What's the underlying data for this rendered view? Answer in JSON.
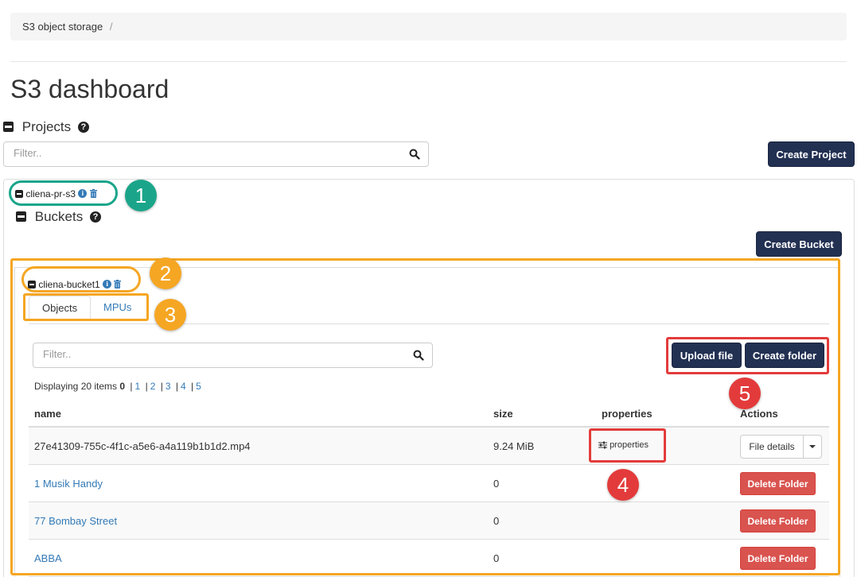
{
  "breadcrumb": {
    "root": "S3 object storage",
    "separator": "/"
  },
  "page_title": "S3 dashboard",
  "projects": {
    "title": "Projects",
    "help_glyph": "?",
    "filter_placeholder": "Filter..",
    "create_button": "Create Project",
    "project_name": "cliena-pr-s3",
    "info_glyph": "i"
  },
  "buckets": {
    "title": "Buckets",
    "help_glyph": "?",
    "create_button": "Create Bucket",
    "bucket_name": "cliena-bucket1",
    "info_glyph": "i"
  },
  "tabs": [
    {
      "label": "Objects",
      "active": true
    },
    {
      "label": "MPUs",
      "active": false
    }
  ],
  "objects": {
    "filter_placeholder": "Filter..",
    "upload_button": "Upload file",
    "create_folder_button": "Create folder",
    "displaying": {
      "prefix": "Displaying 20 items",
      "current": "0",
      "pages": [
        "1",
        "2",
        "3",
        "4",
        "5"
      ]
    },
    "columns": {
      "name": "name",
      "size": "size",
      "properties": "properties",
      "actions": "Actions"
    },
    "rows": [
      {
        "name": "27e41309-755c-4f1c-a5e6-a4a119b1b1d2.mp4",
        "size": "9.24 MiB",
        "properties": "properties",
        "action": "File details"
      },
      {
        "name": "1 Musik Handy",
        "size": "0",
        "action": "Delete Folder"
      },
      {
        "name": "77 Bombay Street",
        "size": "0",
        "action": "Delete Folder"
      },
      {
        "name": "ABBA",
        "size": "0",
        "action": "Delete Folder"
      }
    ]
  },
  "annotations": {
    "labels": [
      "1",
      "2",
      "3",
      "4",
      "5"
    ],
    "colors": {
      "teal": "#1aa58a",
      "orange": "#f5a623",
      "red": "#e33b3b"
    }
  },
  "colors": {
    "primary_dark": "#223052",
    "link": "#337ab7",
    "danger": "#d9534f"
  }
}
